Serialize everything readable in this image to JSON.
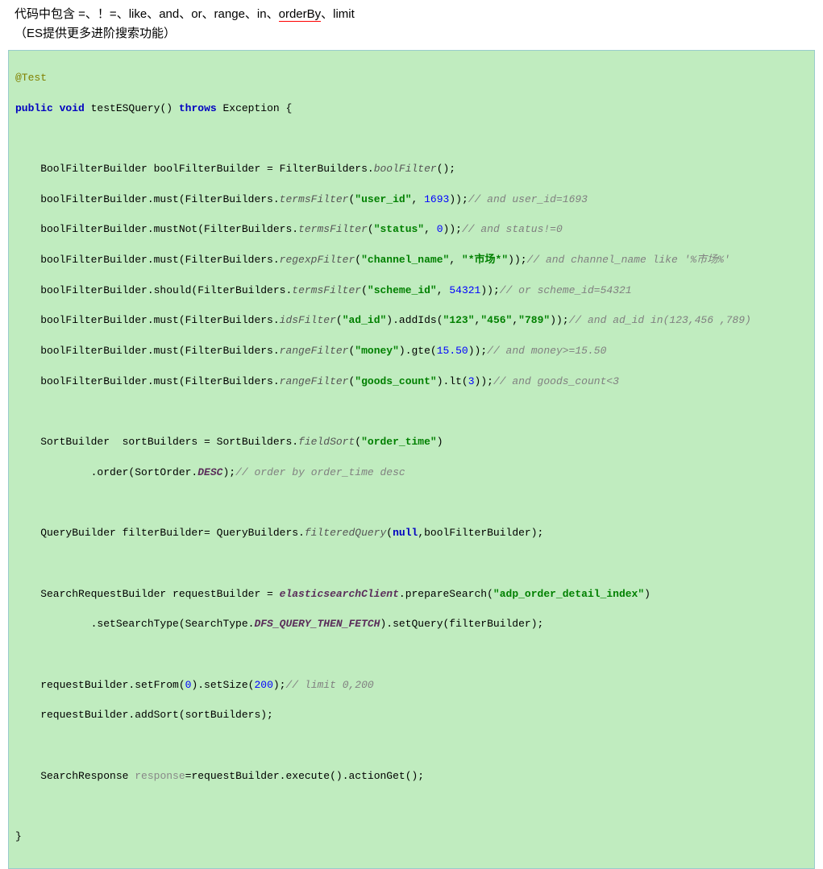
{
  "heading": {
    "line1_parts": [
      "代码中包含 =、！=、like、and、or、range、in、",
      "orderBy",
      "、limit"
    ],
    "line2": "（ES提供更多进阶搜索功能）"
  },
  "code": {
    "annotation": "@Test",
    "sig_kw1": "public void",
    "sig_name": " testESQuery() ",
    "sig_kw2": "throws",
    "sig_rest": " Exception {",
    "l1_a": "    BoolFilterBuilder boolFilterBuilder = FilterBuilders.",
    "l1_m": "boolFilter",
    "l1_b": "();",
    "l2_a": "    boolFilterBuilder.must(FilterBuilders.",
    "l2_m": "termsFilter",
    "l2_b": "(",
    "l2_s": "\"user_id\"",
    "l2_c": ", ",
    "l2_n": "1693",
    "l2_d": "));",
    "l2_cmt": "// and user_id=1693",
    "l3_a": "    boolFilterBuilder.mustNot(FilterBuilders.",
    "l3_m": "termsFilter",
    "l3_b": "(",
    "l3_s": "\"status\"",
    "l3_c": ", ",
    "l3_n": "0",
    "l3_d": "));",
    "l3_cmt": "// and status!=0",
    "l4_a": "    boolFilterBuilder.must(FilterBuilders.",
    "l4_m": "regexpFilter",
    "l4_b": "(",
    "l4_s1": "\"channel_name\"",
    "l4_c": ", ",
    "l4_s2": "\"*市场*\"",
    "l4_d": "));",
    "l4_cmt": "// and channel_name like '%市场%'",
    "l5_a": "    boolFilterBuilder.should(FilterBuilders.",
    "l5_m": "termsFilter",
    "l5_b": "(",
    "l5_s": "\"scheme_id\"",
    "l5_c": ", ",
    "l5_n": "54321",
    "l5_d": "));",
    "l5_cmt": "// or scheme_id=54321",
    "l6_a": "    boolFilterBuilder.must(FilterBuilders.",
    "l6_m": "idsFilter",
    "l6_b": "(",
    "l6_s1": "\"ad_id\"",
    "l6_c": ").addIds(",
    "l6_s2": "\"123\"",
    "l6_d": ",",
    "l6_s3": "\"456\"",
    "l6_e": ",",
    "l6_s4": "\"789\"",
    "l6_f": "));",
    "l6_cmt": "// and ad_id in(123,456 ,789)",
    "l7_a": "    boolFilterBuilder.must(FilterBuilders.",
    "l7_m": "rangeFilter",
    "l7_b": "(",
    "l7_s": "\"money\"",
    "l7_c": ").gte(",
    "l7_n": "15.50",
    "l7_d": "));",
    "l7_cmt": "// and money>=15.50",
    "l8_a": "    boolFilterBuilder.must(FilterBuilders.",
    "l8_m": "rangeFilter",
    "l8_b": "(",
    "l8_s": "\"goods_count\"",
    "l8_c": ").lt(",
    "l8_n": "3",
    "l8_d": "));",
    "l8_cmt": "// and goods_count<3",
    "l9_a": "    SortBuilder  sortBuilders = SortBuilders.",
    "l9_m": "fieldSort",
    "l9_b": "(",
    "l9_s": "\"order_time\"",
    "l9_c": ")",
    "l10_a": "            .order(SortOrder.",
    "l10_cst": "DESC",
    "l10_b": ");",
    "l10_cmt": "// order by order_time desc",
    "l11_a": "    QueryBuilder filterBuilder= QueryBuilders.",
    "l11_m": "filteredQuery",
    "l11_b": "(",
    "l11_kw": "null",
    "l11_c": ",boolFilterBuilder);",
    "l12_a": "    SearchRequestBuilder requestBuilder = ",
    "l12_f": "elasticsearchClient",
    "l12_b": ".prepareSearch(",
    "l12_s": "\"adp_order_detail_index\"",
    "l12_c": ")",
    "l13_a": "            .setSearchType(SearchType.",
    "l13_cst": "DFS_QUERY_THEN_FETCH",
    "l13_b": ").setQuery(filterBuilder);",
    "l14_a": "    requestBuilder.setFrom(",
    "l14_n1": "0",
    "l14_b": ").setSize(",
    "l14_n2": "200",
    "l14_c": ");",
    "l14_cmt": "// limit 0,200",
    "l15": "    requestBuilder.addSort(sortBuilders);",
    "l16_a": "    SearchResponse ",
    "l16_v": "response",
    "l16_b": "=requestBuilder.execute().actionGet();",
    "close": "}"
  }
}
